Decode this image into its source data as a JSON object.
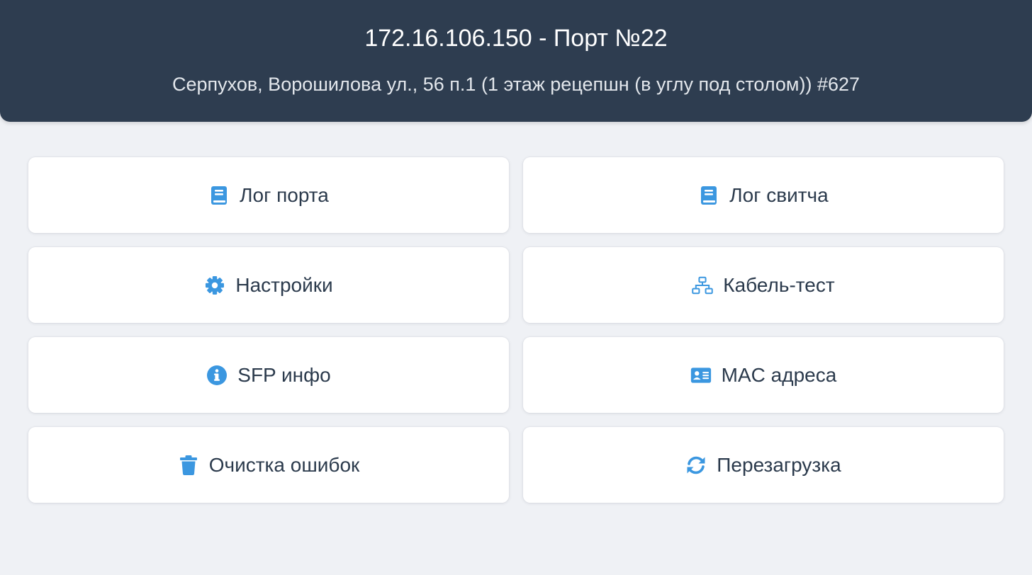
{
  "header": {
    "title": "172.16.106.150 - Порт №22",
    "subtitle": "Серпухов, Ворошилова ул., 56 п.1 (1 этаж рецепшн (в углу под столом)) #627"
  },
  "colors": {
    "header_bg": "#2e3d50",
    "page_bg": "#eff1f5",
    "icon_accent": "#3b97e0",
    "text": "#2b3a4c"
  },
  "actions": [
    {
      "label": "Лог порта",
      "icon": "book-icon"
    },
    {
      "label": "Лог свитча",
      "icon": "book-icon"
    },
    {
      "label": "Настройки",
      "icon": "gear-icon"
    },
    {
      "label": "Кабель-тест",
      "icon": "network-icon"
    },
    {
      "label": "SFP инфо",
      "icon": "info-icon"
    },
    {
      "label": "MAC адреса",
      "icon": "id-card-icon"
    },
    {
      "label": "Очистка ошибок",
      "icon": "trash-icon"
    },
    {
      "label": "Перезагрузка",
      "icon": "refresh-icon"
    }
  ]
}
